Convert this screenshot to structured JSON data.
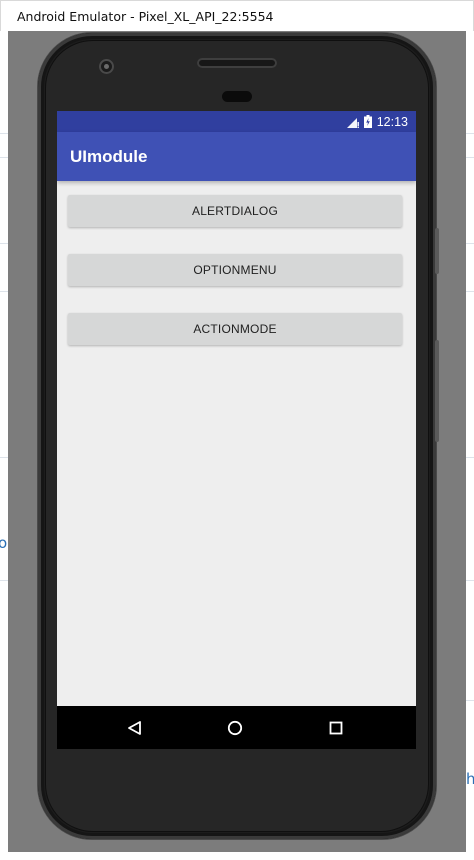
{
  "window": {
    "title": "Android Emulator - Pixel_XL_API_22:5554"
  },
  "background": {
    "fragment_left": "o",
    "fragment_right": "h"
  },
  "status_bar": {
    "time": "12:13",
    "icons": [
      "signal-icon",
      "battery-icon"
    ]
  },
  "app_bar": {
    "title": "UImodule"
  },
  "buttons": {
    "alert_dialog": "ALERTDIALOG",
    "option_menu": "OPTIONMENU",
    "action_mode": "ACTIONMODE"
  },
  "nav_bar": {
    "icons": [
      "back-icon",
      "home-icon",
      "recents-icon"
    ]
  },
  "colors": {
    "status_bar": "#303f9f",
    "app_bar": "#3f51b5",
    "screen_bg": "#eeeeee",
    "button_bg": "#d6d7d7",
    "nav_bar": "#000000"
  }
}
